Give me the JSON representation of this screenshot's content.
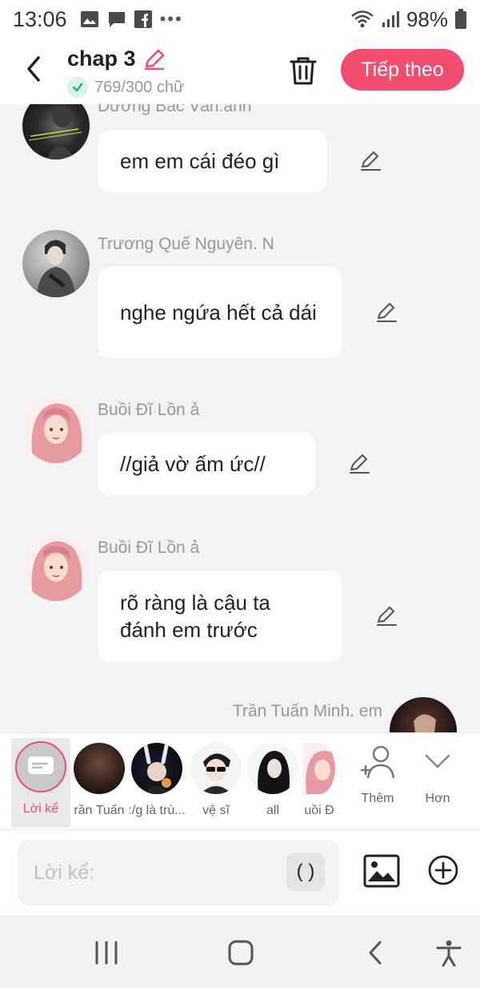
{
  "status_bar": {
    "time": "13:06",
    "battery": "98%",
    "icons": [
      "gallery-icon",
      "message-icon",
      "facebook-icon",
      "more-icon",
      "wifi-icon",
      "signal-icon",
      "battery-icon"
    ]
  },
  "header": {
    "title": "chap 3",
    "word_count": "769/300 chữ",
    "next_label": "Tiếp theo",
    "accent_color": "#f24d6e"
  },
  "messages": [
    {
      "sender": "Dương Bắc Vân.anh",
      "text": "em em cái đéo gì"
    },
    {
      "sender": "Trương Quế Nguyên. N",
      "text": "nghe ngứa hết cả dái"
    },
    {
      "sender": "Buồi Đĩ Lồn ả",
      "text": "//giả vờ ấm ức//"
    },
    {
      "sender": "Buồi Đĩ Lồn ả",
      "text": "rõ ràng là cậu ta đánh em trước"
    },
    {
      "sender": "Trần Tuấn Minh. em",
      "text": ""
    }
  ],
  "characters": {
    "narrator": "Lời kể",
    "items": [
      "rần Tuấn",
      ":/g là trù...",
      "vệ sĩ",
      "all",
      "uồi Đ"
    ],
    "add_label": "Thêm",
    "more_label": "Hơn"
  },
  "composer": {
    "placeholder": "Lời kể:",
    "paren_label": "( )"
  }
}
